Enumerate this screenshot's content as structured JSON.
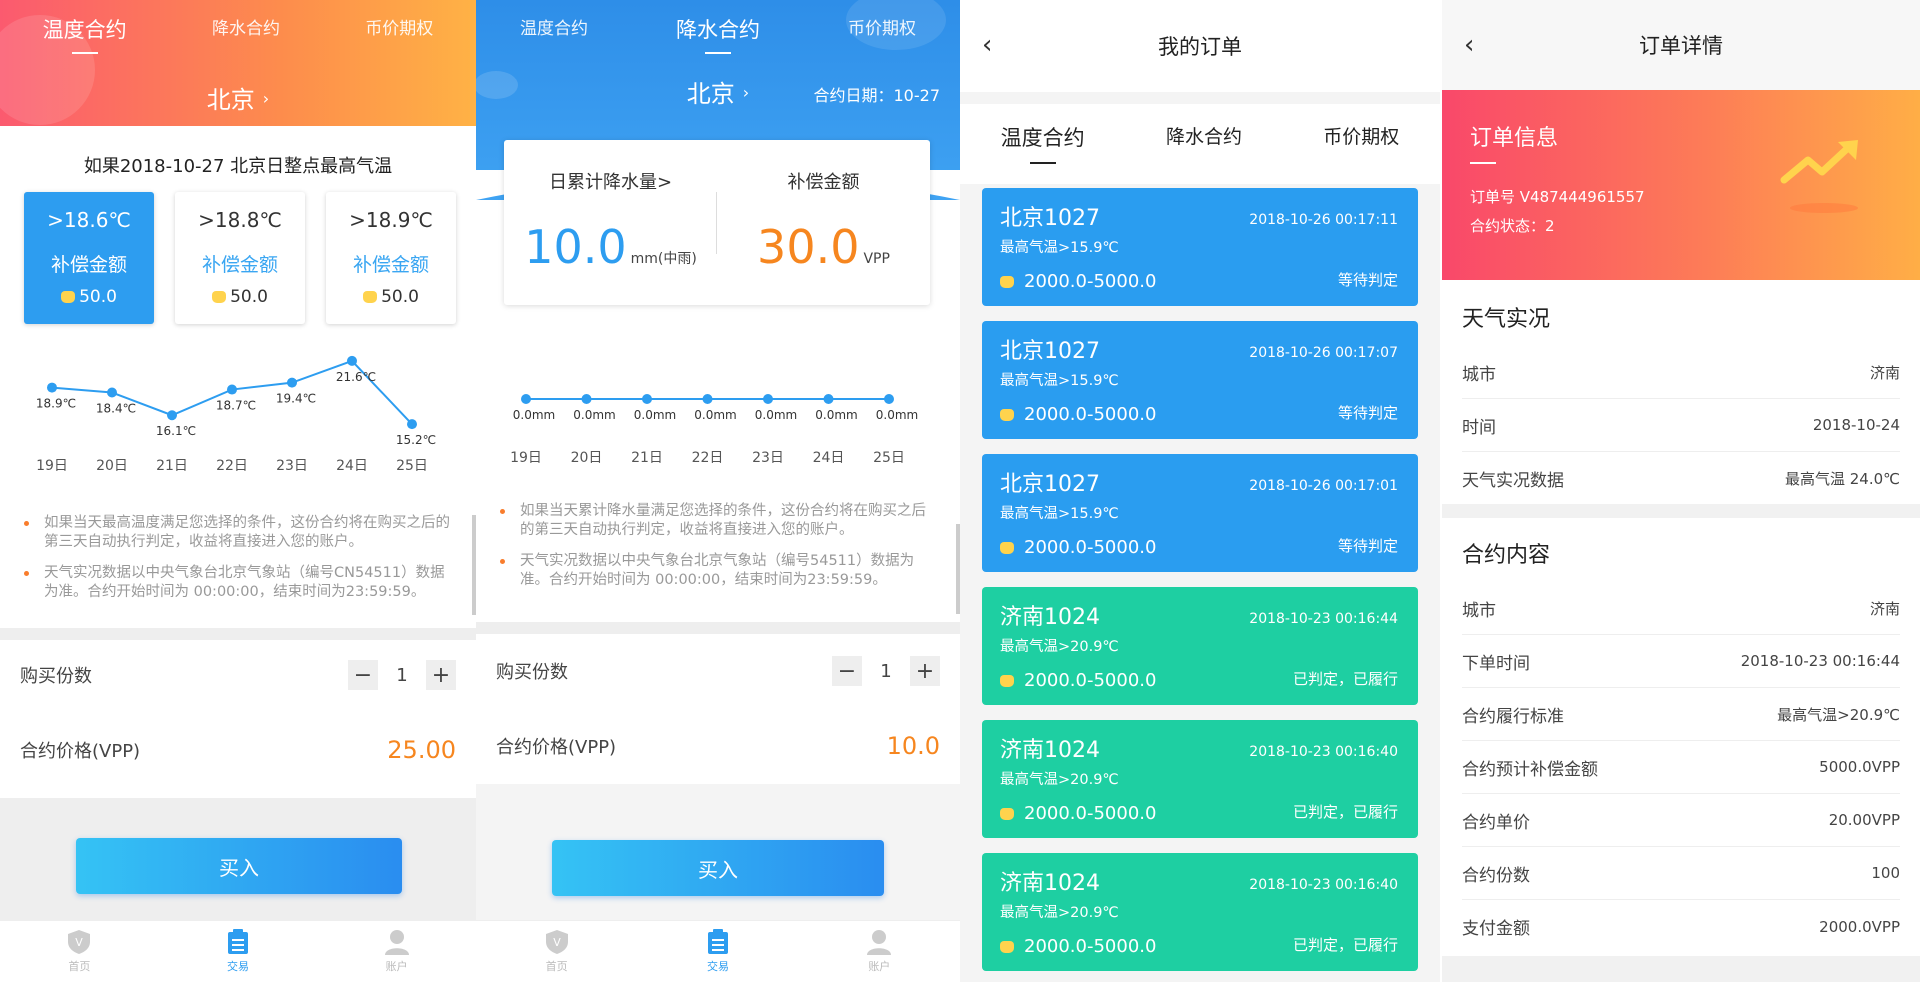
{
  "p1": {
    "tabs": [
      "温度合约",
      "降水合约",
      "币价期权"
    ],
    "city": "北京",
    "condition": "如果2018-10-27 北京日整点最高气温",
    "options": [
      {
        "threshold": ">18.6℃",
        "label": "补偿金额",
        "value": "50.0"
      },
      {
        "threshold": ">18.8℃",
        "label": "补偿金额",
        "value": "50.0"
      },
      {
        "threshold": ">18.9℃",
        "label": "补偿金额",
        "value": "50.0"
      }
    ],
    "notes": [
      "如果当天最高温度满足您选择的条件，这份合约将在购买之后的第三天自动执行判定，收益将直接进入您的账户。",
      "天气实况数据以中央气象台北京气象站（编号CN54511）数据为准。合约开始时间为 00:00:00，结束时间为23:59:59。"
    ],
    "qty_label": "购买份数",
    "qty": "1",
    "price_label": "合约价格(VPP)",
    "price": "25.00",
    "buy": "买入",
    "nav": [
      "首页",
      "交易",
      "账户"
    ]
  },
  "p2": {
    "tabs": [
      "温度合约",
      "降水合约",
      "币价期权"
    ],
    "city": "北京",
    "date": "合约日期：10-27",
    "left_label": "日累计降水量>",
    "left_value": "10.0",
    "left_unit": "mm(中雨)",
    "right_label": "补偿金额",
    "right_value": "30.0",
    "right_unit": "VPP",
    "notes": [
      "如果当天累计降水量满足您选择的条件，这份合约将在购买之后的第三天自动执行判定，收益将直接进入您的账户。",
      "天气实况数据以中央气象台北京气象站（编号54511）数据为准。合约开始时间为 00:00:00，结束时间为23:59:59。"
    ],
    "qty_label": "购买份数",
    "qty": "1",
    "price_label": "合约价格(VPP)",
    "price": "10.0",
    "buy": "买入",
    "nav": [
      "首页",
      "交易",
      "账户"
    ]
  },
  "p3": {
    "title": "我的订单",
    "tabs": [
      "温度合约",
      "降水合约",
      "币价期权"
    ],
    "orders": [
      {
        "name": "北京1027",
        "date": "2018-10-26 00:17:11",
        "cond": "最高气温>15.9℃",
        "amount": "2000.0-5000.0",
        "status": "等待判定",
        "color": "blue"
      },
      {
        "name": "北京1027",
        "date": "2018-10-26 00:17:07",
        "cond": "最高气温>15.9℃",
        "amount": "2000.0-5000.0",
        "status": "等待判定",
        "color": "blue"
      },
      {
        "name": "北京1027",
        "date": "2018-10-26 00:17:01",
        "cond": "最高气温>15.9℃",
        "amount": "2000.0-5000.0",
        "status": "等待判定",
        "color": "blue"
      },
      {
        "name": "济南1024",
        "date": "2018-10-23 00:16:44",
        "cond": "最高气温>20.9℃",
        "amount": "2000.0-5000.0",
        "status": "已判定，已履行",
        "color": "green"
      },
      {
        "name": "济南1024",
        "date": "2018-10-23 00:16:40",
        "cond": "最高气温>20.9℃",
        "amount": "2000.0-5000.0",
        "status": "已判定，已履行",
        "color": "green"
      },
      {
        "name": "济南1024",
        "date": "2018-10-23 00:16:40",
        "cond": "最高气温>20.9℃",
        "amount": "2000.0-5000.0",
        "status": "已判定，已履行",
        "color": "green"
      }
    ]
  },
  "p4": {
    "title": "订单详情",
    "card_title": "订单信息",
    "order_no": "订单号 V487444961557",
    "order_status": "合约状态：2",
    "weather_title": "天气实况",
    "weather": [
      {
        "k": "城市",
        "v": "济南"
      },
      {
        "k": "时间",
        "v": "2018-10-24"
      },
      {
        "k": "天气实况数据",
        "v": "最高气温 24.0℃"
      }
    ],
    "contract_title": "合约内容",
    "contract": [
      {
        "k": "城市",
        "v": "济南"
      },
      {
        "k": "下单时间",
        "v": "2018-10-23 00:16:44"
      },
      {
        "k": "合约履行标准",
        "v": "最高气温>20.9℃"
      },
      {
        "k": "合约预计补偿金额",
        "v": "5000.0VPP"
      },
      {
        "k": "合约单价",
        "v": "20.00VPP"
      },
      {
        "k": "合约份数",
        "v": "100"
      },
      {
        "k": "支付金额",
        "v": "2000.0VPP"
      }
    ]
  },
  "chart_data": [
    {
      "type": "line",
      "categories": [
        "19日",
        "20日",
        "21日",
        "22日",
        "23日",
        "24日",
        "25日"
      ],
      "values": [
        18.9,
        18.4,
        16.1,
        18.7,
        19.4,
        21.6,
        15.2
      ],
      "point_labels": [
        "18.9℃",
        "18.4℃",
        "16.1℃",
        "18.7℃",
        "19.4℃",
        "21.6℃",
        "15.2℃"
      ],
      "color": "#2d9df0"
    },
    {
      "type": "line",
      "categories": [
        "19日",
        "20日",
        "21日",
        "22日",
        "23日",
        "24日",
        "25日"
      ],
      "values": [
        0,
        0,
        0,
        0,
        0,
        0,
        0
      ],
      "point_labels": [
        "0.0mm",
        "0.0mm",
        "0.0mm",
        "0.0mm",
        "0.0mm",
        "0.0mm",
        "0.0mm"
      ],
      "color": "#2d9df0"
    }
  ]
}
